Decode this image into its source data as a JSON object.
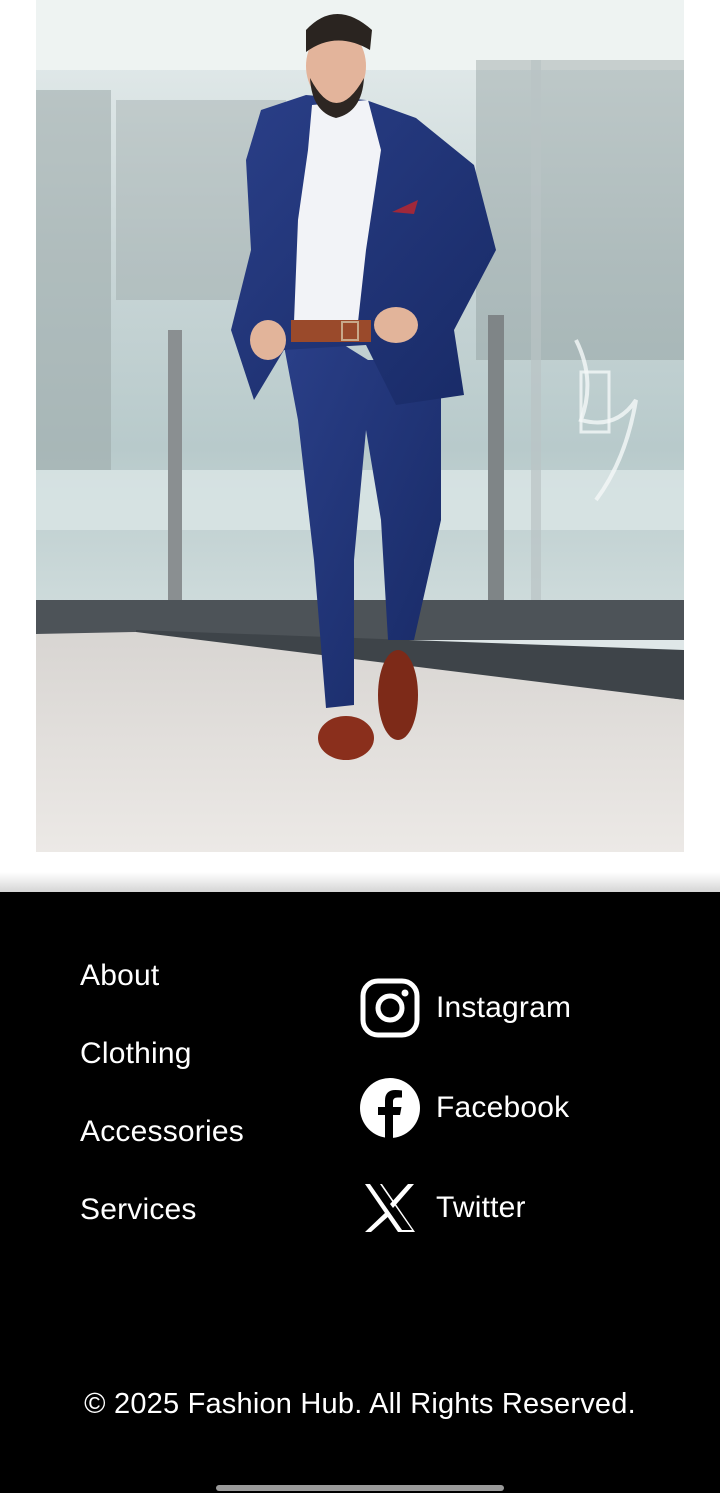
{
  "hero": {
    "image_description_icon": "model-in-navy-suit-photo"
  },
  "footer": {
    "nav": [
      {
        "label": "About"
      },
      {
        "label": "Clothing"
      },
      {
        "label": "Accessories"
      },
      {
        "label": "Services"
      }
    ],
    "social": [
      {
        "label": "Instagram",
        "icon": "instagram-icon"
      },
      {
        "label": "Facebook",
        "icon": "facebook-icon"
      },
      {
        "label": "Twitter",
        "icon": "x-twitter-icon"
      }
    ],
    "copyright": "© 2025 Fashion Hub. All Rights Reserved."
  },
  "colors": {
    "footer_bg": "#000000",
    "footer_text": "#ffffff",
    "page_bg": "#ffffff"
  }
}
